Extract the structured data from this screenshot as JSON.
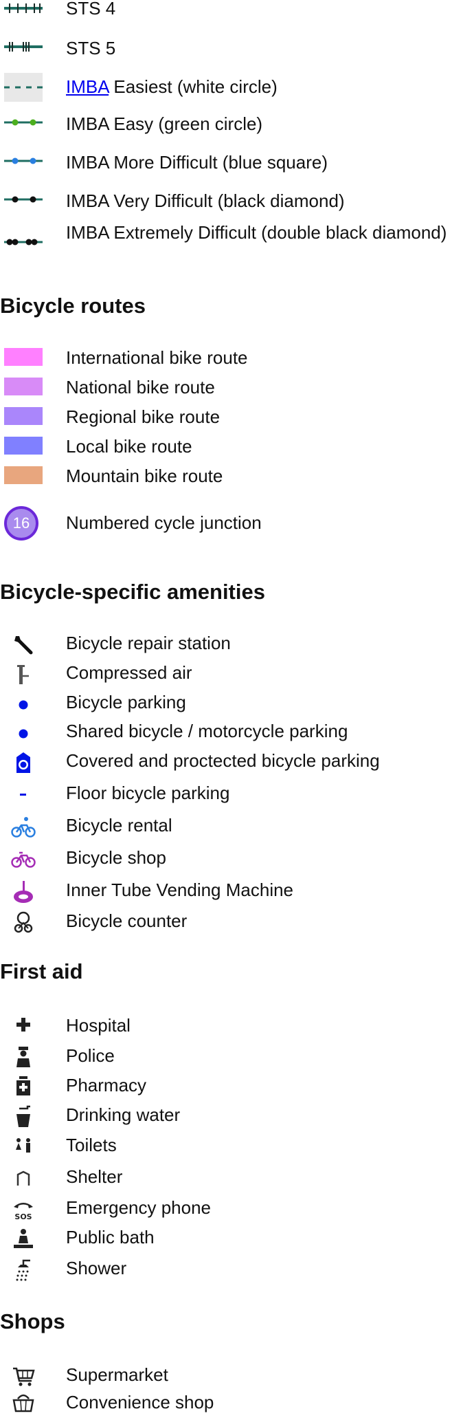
{
  "trail_scales": [
    {
      "label": "STS 4"
    },
    {
      "label": "STS 5"
    },
    {
      "link": "IMBA",
      "label": " Easiest (white circle)"
    },
    {
      "label": "IMBA Easy (green circle)"
    },
    {
      "label": "IMBA More Difficult (blue square)"
    },
    {
      "label": "IMBA Very Difficult (black diamond)"
    },
    {
      "label": "IMBA Extremely Difficult (double black diamond)"
    }
  ],
  "bicycle_routes": {
    "heading": "Bicycle routes",
    "items": [
      {
        "label": "International bike route",
        "color": "#ff80ff"
      },
      {
        "label": "National bike route",
        "color": "#d88bf7"
      },
      {
        "label": "Regional bike route",
        "color": "#aa86fb"
      },
      {
        "label": "Local bike route",
        "color": "#8080ff"
      },
      {
        "label": "Mountain bike route",
        "color": "#e8a67e"
      }
    ],
    "junction": {
      "number": "16",
      "label": "Numbered cycle junction"
    }
  },
  "amenities": {
    "heading": "Bicycle-specific amenities",
    "items": [
      {
        "label": "Bicycle repair station",
        "icon": "wrench-icon"
      },
      {
        "label": "Compressed air",
        "icon": "air-pump-icon"
      },
      {
        "label": "Bicycle parking",
        "icon": "parking-dot-icon"
      },
      {
        "label": "Shared bicycle / motorcycle parking",
        "icon": "parking-dot-icon"
      },
      {
        "label": "Covered and proctected bicycle parking",
        "icon": "covered-parking-icon"
      },
      {
        "label": "Floor bicycle parking",
        "icon": "floor-parking-icon"
      },
      {
        "label": "Bicycle rental",
        "icon": "bicycle-rental-icon"
      },
      {
        "label": "Bicycle shop",
        "icon": "bicycle-shop-icon"
      },
      {
        "label": "Inner Tube Vending Machine",
        "icon": "inner-tube-icon"
      },
      {
        "label": "Bicycle counter",
        "icon": "bicycle-counter-icon"
      }
    ]
  },
  "first_aid": {
    "heading": "First aid",
    "items": [
      {
        "label": "Hospital",
        "icon": "cross-icon"
      },
      {
        "label": "Police",
        "icon": "police-icon"
      },
      {
        "label": "Pharmacy",
        "icon": "pharmacy-icon"
      },
      {
        "label": "Drinking water",
        "icon": "drinking-water-icon"
      },
      {
        "label": "Toilets",
        "icon": "toilets-icon"
      },
      {
        "label": "Shelter",
        "icon": "shelter-icon"
      },
      {
        "label": "Emergency phone",
        "icon": "sos-phone-icon"
      },
      {
        "label": "Public bath",
        "icon": "public-bath-icon"
      },
      {
        "label": "Shower",
        "icon": "shower-icon"
      }
    ]
  },
  "shops": {
    "heading": "Shops",
    "items": [
      {
        "label": "Supermarket",
        "icon": "cart-icon"
      },
      {
        "label": "Convenience shop",
        "icon": "basket-icon"
      }
    ]
  }
}
